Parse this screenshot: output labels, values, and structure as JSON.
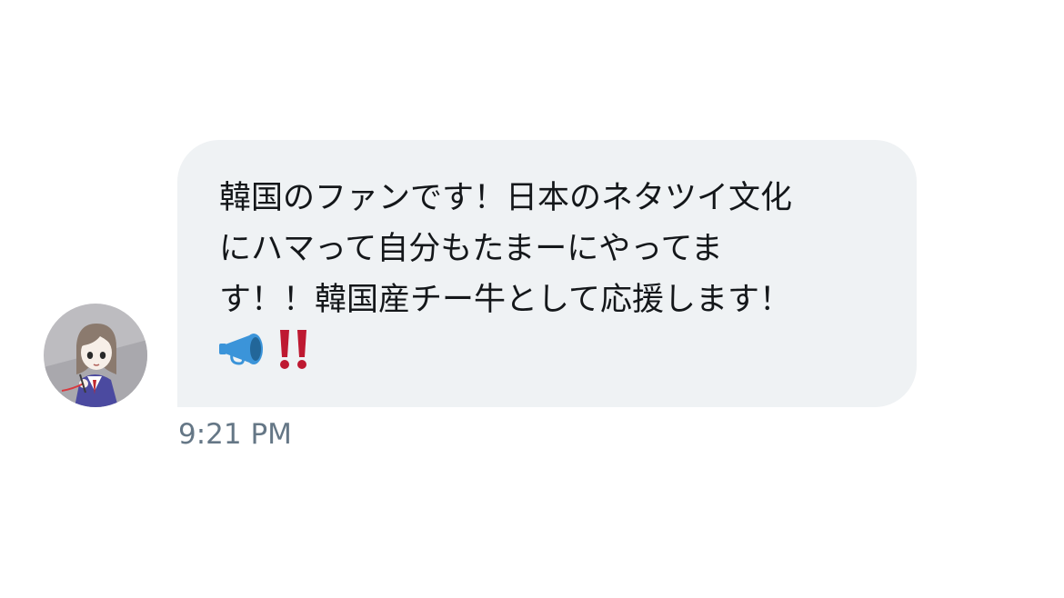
{
  "conversation": {
    "message": {
      "text": "韓国のファンです！日本のネタツイ文化\nにハマって自分もたまーにやってま\nす！！韓国産チー牛として応援します！",
      "emojis": [
        "megaphone-icon",
        "double-exclamation-icon"
      ],
      "timestamp": "9:21 PM"
    },
    "sender": {
      "avatar_icon": "anime-girl-avatar"
    }
  },
  "colors": {
    "bubble_background": "#eff2f4",
    "text": "#14171a",
    "timestamp": "#657786",
    "megaphone": "#3b94d9",
    "exclamation": "#be1931"
  }
}
